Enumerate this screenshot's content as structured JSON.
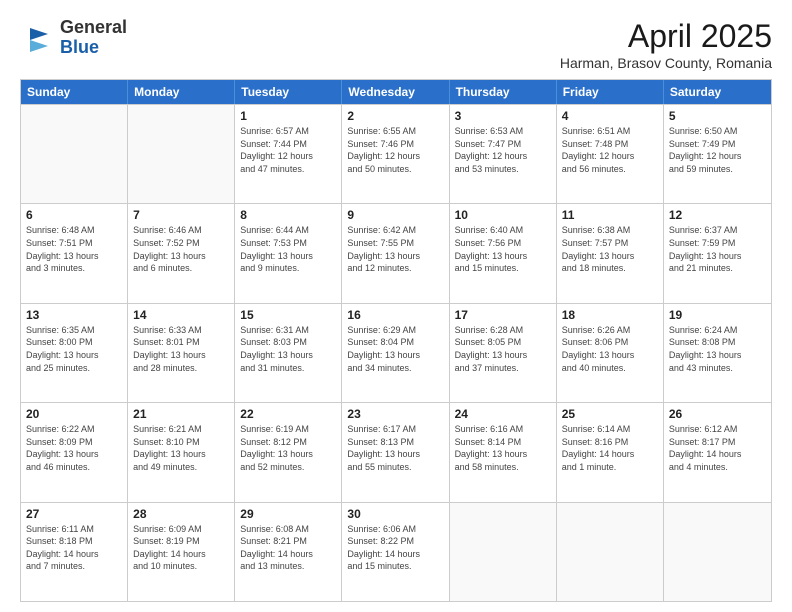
{
  "header": {
    "logo_general": "General",
    "logo_blue": "Blue",
    "month_title": "April 2025",
    "subtitle": "Harman, Brasov County, Romania"
  },
  "weekdays": [
    "Sunday",
    "Monday",
    "Tuesday",
    "Wednesday",
    "Thursday",
    "Friday",
    "Saturday"
  ],
  "weeks": [
    [
      {
        "day": "",
        "info": ""
      },
      {
        "day": "",
        "info": ""
      },
      {
        "day": "1",
        "info": "Sunrise: 6:57 AM\nSunset: 7:44 PM\nDaylight: 12 hours\nand 47 minutes."
      },
      {
        "day": "2",
        "info": "Sunrise: 6:55 AM\nSunset: 7:46 PM\nDaylight: 12 hours\nand 50 minutes."
      },
      {
        "day": "3",
        "info": "Sunrise: 6:53 AM\nSunset: 7:47 PM\nDaylight: 12 hours\nand 53 minutes."
      },
      {
        "day": "4",
        "info": "Sunrise: 6:51 AM\nSunset: 7:48 PM\nDaylight: 12 hours\nand 56 minutes."
      },
      {
        "day": "5",
        "info": "Sunrise: 6:50 AM\nSunset: 7:49 PM\nDaylight: 12 hours\nand 59 minutes."
      }
    ],
    [
      {
        "day": "6",
        "info": "Sunrise: 6:48 AM\nSunset: 7:51 PM\nDaylight: 13 hours\nand 3 minutes."
      },
      {
        "day": "7",
        "info": "Sunrise: 6:46 AM\nSunset: 7:52 PM\nDaylight: 13 hours\nand 6 minutes."
      },
      {
        "day": "8",
        "info": "Sunrise: 6:44 AM\nSunset: 7:53 PM\nDaylight: 13 hours\nand 9 minutes."
      },
      {
        "day": "9",
        "info": "Sunrise: 6:42 AM\nSunset: 7:55 PM\nDaylight: 13 hours\nand 12 minutes."
      },
      {
        "day": "10",
        "info": "Sunrise: 6:40 AM\nSunset: 7:56 PM\nDaylight: 13 hours\nand 15 minutes."
      },
      {
        "day": "11",
        "info": "Sunrise: 6:38 AM\nSunset: 7:57 PM\nDaylight: 13 hours\nand 18 minutes."
      },
      {
        "day": "12",
        "info": "Sunrise: 6:37 AM\nSunset: 7:59 PM\nDaylight: 13 hours\nand 21 minutes."
      }
    ],
    [
      {
        "day": "13",
        "info": "Sunrise: 6:35 AM\nSunset: 8:00 PM\nDaylight: 13 hours\nand 25 minutes."
      },
      {
        "day": "14",
        "info": "Sunrise: 6:33 AM\nSunset: 8:01 PM\nDaylight: 13 hours\nand 28 minutes."
      },
      {
        "day": "15",
        "info": "Sunrise: 6:31 AM\nSunset: 8:03 PM\nDaylight: 13 hours\nand 31 minutes."
      },
      {
        "day": "16",
        "info": "Sunrise: 6:29 AM\nSunset: 8:04 PM\nDaylight: 13 hours\nand 34 minutes."
      },
      {
        "day": "17",
        "info": "Sunrise: 6:28 AM\nSunset: 8:05 PM\nDaylight: 13 hours\nand 37 minutes."
      },
      {
        "day": "18",
        "info": "Sunrise: 6:26 AM\nSunset: 8:06 PM\nDaylight: 13 hours\nand 40 minutes."
      },
      {
        "day": "19",
        "info": "Sunrise: 6:24 AM\nSunset: 8:08 PM\nDaylight: 13 hours\nand 43 minutes."
      }
    ],
    [
      {
        "day": "20",
        "info": "Sunrise: 6:22 AM\nSunset: 8:09 PM\nDaylight: 13 hours\nand 46 minutes."
      },
      {
        "day": "21",
        "info": "Sunrise: 6:21 AM\nSunset: 8:10 PM\nDaylight: 13 hours\nand 49 minutes."
      },
      {
        "day": "22",
        "info": "Sunrise: 6:19 AM\nSunset: 8:12 PM\nDaylight: 13 hours\nand 52 minutes."
      },
      {
        "day": "23",
        "info": "Sunrise: 6:17 AM\nSunset: 8:13 PM\nDaylight: 13 hours\nand 55 minutes."
      },
      {
        "day": "24",
        "info": "Sunrise: 6:16 AM\nSunset: 8:14 PM\nDaylight: 13 hours\nand 58 minutes."
      },
      {
        "day": "25",
        "info": "Sunrise: 6:14 AM\nSunset: 8:16 PM\nDaylight: 14 hours\nand 1 minute."
      },
      {
        "day": "26",
        "info": "Sunrise: 6:12 AM\nSunset: 8:17 PM\nDaylight: 14 hours\nand 4 minutes."
      }
    ],
    [
      {
        "day": "27",
        "info": "Sunrise: 6:11 AM\nSunset: 8:18 PM\nDaylight: 14 hours\nand 7 minutes."
      },
      {
        "day": "28",
        "info": "Sunrise: 6:09 AM\nSunset: 8:19 PM\nDaylight: 14 hours\nand 10 minutes."
      },
      {
        "day": "29",
        "info": "Sunrise: 6:08 AM\nSunset: 8:21 PM\nDaylight: 14 hours\nand 13 minutes."
      },
      {
        "day": "30",
        "info": "Sunrise: 6:06 AM\nSunset: 8:22 PM\nDaylight: 14 hours\nand 15 minutes."
      },
      {
        "day": "",
        "info": ""
      },
      {
        "day": "",
        "info": ""
      },
      {
        "day": "",
        "info": ""
      }
    ]
  ]
}
